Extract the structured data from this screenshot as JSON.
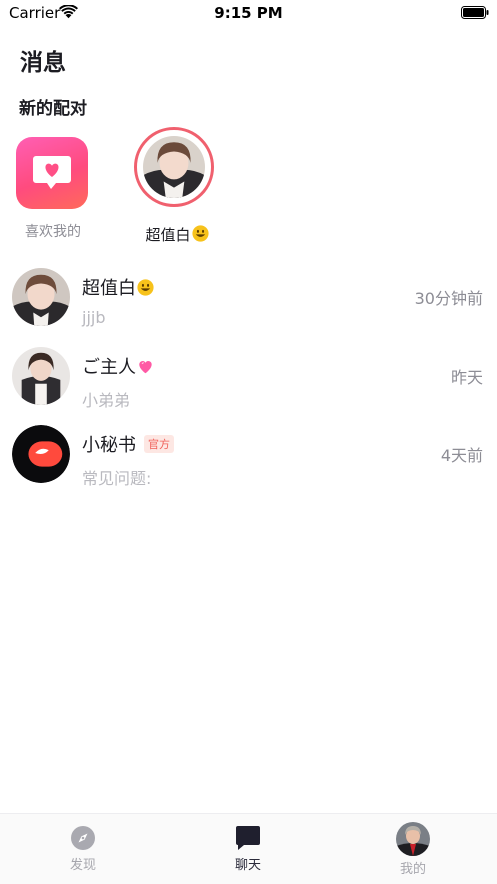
{
  "status_bar": {
    "carrier": "Carrier",
    "time": "9:15 PM",
    "wifi_icon": "wifi-icon",
    "battery_icon": "battery-icon"
  },
  "header": {
    "title": "消息",
    "new_matches_title": "新的配对"
  },
  "new_matches": {
    "likes": {
      "label": "喜欢我的",
      "icon": "heart-message-icon",
      "gradient": [
        "#ff5fb4",
        "#ff4b7e",
        "#ff6a5a"
      ]
    },
    "match": {
      "name": "超值白",
      "emoji": "smiley-emoji-icon",
      "ring_color": "#f0606e"
    }
  },
  "conversations": [
    {
      "name": "超值白",
      "emoji": "smiley-emoji-icon",
      "preview": "jjjb",
      "time": "30分钟前"
    },
    {
      "name": "ご主人",
      "emoji": "pink-heart-emoji-icon",
      "preview": "小弟弟",
      "time": "昨天"
    },
    {
      "name": "小秘书",
      "badge": "官方",
      "preview": "常见问题:",
      "time": "4天前",
      "avatar_icon": "app-logo-icon"
    }
  ],
  "tab_bar": {
    "tabs": [
      {
        "label": "发现",
        "icon": "compass-icon",
        "active": false
      },
      {
        "label": "聊天",
        "icon": "chat-bubble-icon",
        "active": true
      },
      {
        "label": "我的",
        "icon": "profile-avatar",
        "active": false
      }
    ]
  },
  "colors": {
    "accent_red": "#f0606e",
    "badge_text": "#f0605a",
    "badge_bg": "#fde7e3",
    "muted_text": "#8d8d95",
    "preview_text": "#b9b9bf"
  }
}
